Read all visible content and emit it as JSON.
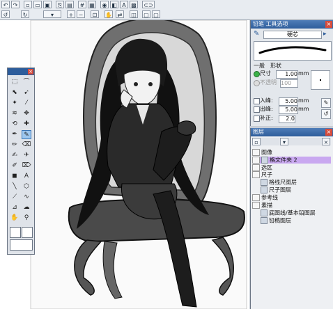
{
  "brush_panel": {
    "title": "铅笔 工具选项",
    "brush_name": "硬芯",
    "tabs": [
      "一般",
      "形状"
    ],
    "size_label": "尺寸",
    "size_value": "1.00",
    "size_unit": "mm",
    "opacity_label": "不透明",
    "opacity_value": "100",
    "entry_label": "入峰:",
    "entry_value": "5.00",
    "entry_unit": "mm",
    "exit_label": "出峰:",
    "exit_value": "5.00",
    "exit_unit": "mm",
    "correct_label": "补正:",
    "correct_value": "2.0"
  },
  "layer_panel": {
    "title": "图层",
    "rows": [
      {
        "label": "图像",
        "kind": "group"
      },
      {
        "label": "格文件夹 2",
        "kind": "selected"
      },
      {
        "label": "选区",
        "kind": "group"
      },
      {
        "label": "尺子",
        "kind": "group"
      },
      {
        "label": "格线尺图层",
        "kind": "layer"
      },
      {
        "label": "尺子图层",
        "kind": "layer"
      },
      {
        "label": "参考线",
        "kind": "group"
      },
      {
        "label": "素描",
        "kind": "group"
      },
      {
        "label": "底图线/基本铅图层",
        "kind": "layer"
      },
      {
        "label": "铅稿图层",
        "kind": "layer"
      }
    ]
  },
  "colors": {
    "accent": "#2e5d9b",
    "selected_layer": "#c9a8f0",
    "close": "#d74c3c"
  }
}
